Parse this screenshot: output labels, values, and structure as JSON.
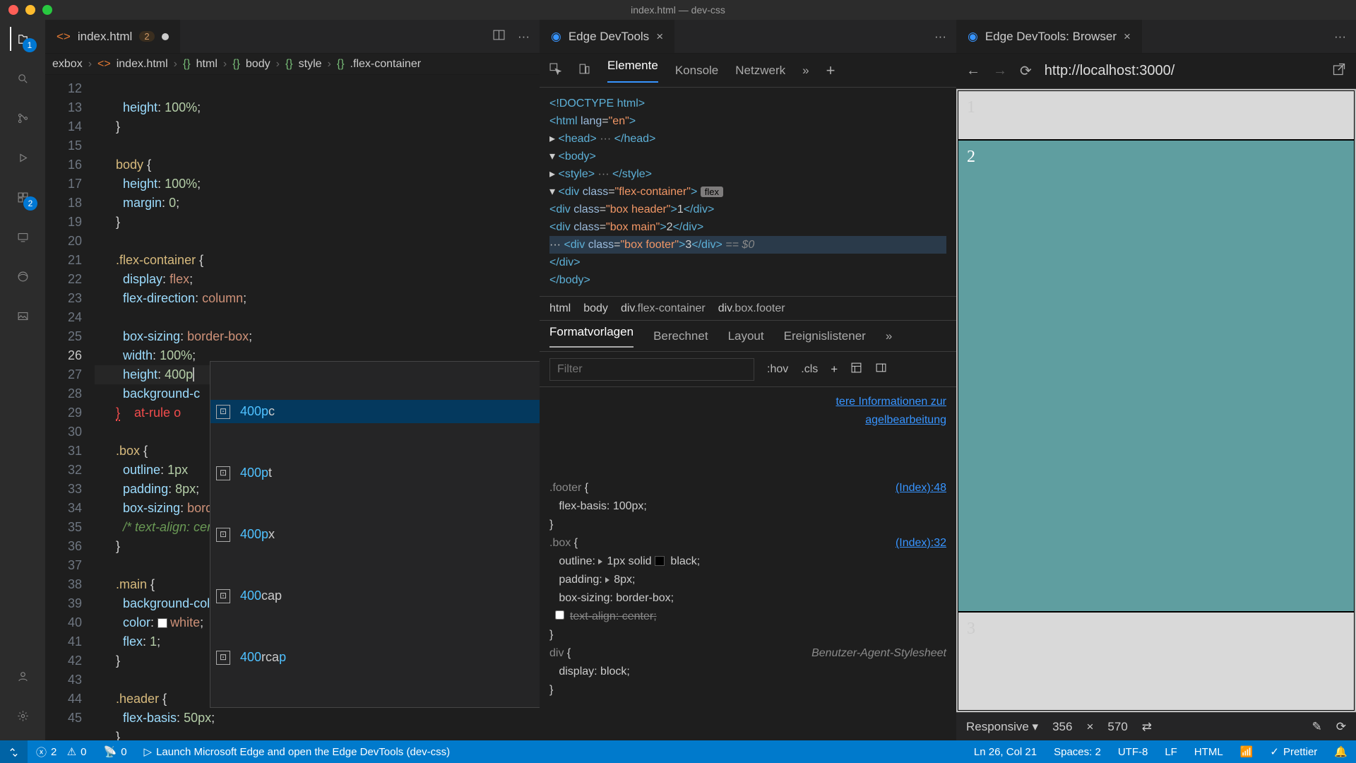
{
  "window_title": "index.html — dev-css",
  "activity": {
    "explorer_badge": "1",
    "ext_badge": "2"
  },
  "editor": {
    "tab": {
      "name": "index.html",
      "errors": "2"
    },
    "breadcrumbs": [
      "exbox",
      "index.html",
      "html",
      "body",
      "style",
      ".flex-container"
    ],
    "gutter": [
      "12",
      "13",
      "14",
      "15",
      "16",
      "17",
      "18",
      "19",
      "20",
      "21",
      "22",
      "23",
      "24",
      "25",
      "26",
      "27",
      "28",
      "29",
      "30",
      "31",
      "32",
      "33",
      "34",
      "35",
      "36",
      "37",
      "38",
      "39",
      "40",
      "41",
      "42",
      "43",
      "44",
      "45"
    ],
    "autocomplete": [
      "400pc",
      "400pt",
      "400px",
      "400cap",
      "400rcap"
    ]
  },
  "devtools": {
    "tab_label": "Edge DevTools",
    "top_tabs": [
      "Elemente",
      "Konsole",
      "Netzwerk"
    ],
    "dom": {
      "doctype": "<!DOCTYPE html>",
      "html": "<html lang=\"en\">",
      "head": "<head> ··· </head>",
      "body": "<body>",
      "style": "<style> ··· </style>",
      "fc_open": "<div class=\"flex-container\">",
      "pill": "flex",
      "d1": "<div class=\"box header\">1</div>",
      "d2": "<div class=\"box main\">2</div>",
      "d3": "<div class=\"box footer\">3</div>",
      "d3_note": "== $0",
      "close_div": "</div>",
      "close_body": "</body>"
    },
    "crumbs": [
      "html",
      "body",
      "div.flex-container",
      "div.box.footer"
    ],
    "mid_tabs": [
      "Formatvorlagen",
      "Berechnet",
      "Layout",
      "Ereignislistener"
    ],
    "filter_placeholder": "Filter",
    "chips": [
      ":hov",
      ".cls"
    ],
    "info_link_1": "tere Informationen zur",
    "info_link_2": "agelbearbeitung",
    "rule1_src": "(Index):48",
    "rule1_sel": ".footer {",
    "rule1_p1": "flex-basis: 100px;",
    "rule2_src": "(Index):32",
    "rule2_sel": ".box {",
    "rule2_p1": "outline:",
    "rule2_p1v": "1px solid ▪ black;",
    "rule2_p2": "padding:",
    "rule2_p2v": "8px;",
    "rule2_p3": "box-sizing: border-box;",
    "rule2_p4": "text-align: center;",
    "ua_label": "Benutzer-Agent-Stylesheet",
    "rule3_sel": "div {",
    "rule3_p1": "display: block;"
  },
  "browser": {
    "tab_label": "Edge DevTools: Browser",
    "url": "http://localhost:3000/",
    "boxes": [
      "1",
      "2",
      "3"
    ],
    "device": "Responsive",
    "w": "356",
    "h": "570"
  },
  "status": {
    "errors": "2",
    "warnings": "0",
    "port": "0",
    "launch": "Launch Microsoft Edge and open the Edge DevTools (dev-css)",
    "pos": "Ln 26, Col 21",
    "spaces": "Spaces: 2",
    "enc": "UTF-8",
    "eol": "LF",
    "lang": "HTML",
    "prettier": "Prettier"
  }
}
